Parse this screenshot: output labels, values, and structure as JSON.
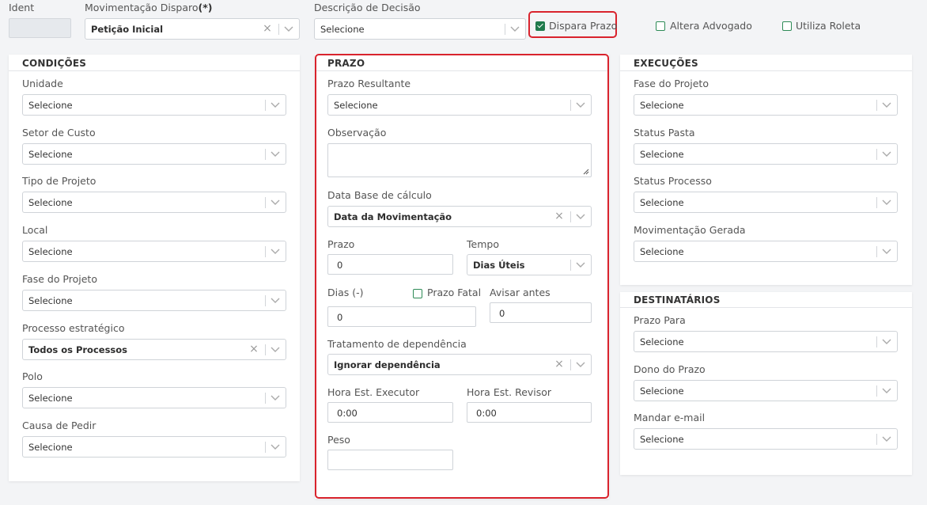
{
  "header": {
    "ident_label": "Ident",
    "movimentacao_label": "Movimentação Disparo",
    "movimentacao_required": "(*)",
    "movimentacao_value": "Petição Inicial",
    "descricao_label": "Descrição de Decisão",
    "descricao_value": "Selecione",
    "dispara_prazo_label": "Dispara Prazo",
    "altera_advogado_label": "Altera Advogado",
    "utiliza_roleta_label": "Utiliza Roleta"
  },
  "condicoes": {
    "title": "CONDIÇÕES",
    "fields": [
      {
        "label": "Unidade",
        "value": "Selecione"
      },
      {
        "label": "Setor de Custo",
        "value": "Selecione"
      },
      {
        "label": "Tipo de Projeto",
        "value": "Selecione"
      },
      {
        "label": "Local",
        "value": "Selecione"
      },
      {
        "label": "Fase do Projeto",
        "value": "Selecione"
      },
      {
        "label": "Processo estratégico",
        "value": "Todos os Processos"
      },
      {
        "label": "Polo",
        "value": "Selecione"
      },
      {
        "label": "Causa de Pedir",
        "value": "Selecione"
      }
    ]
  },
  "prazo": {
    "title": "PRAZO",
    "prazo_resultante_label": "Prazo Resultante",
    "prazo_resultante_value": "Selecione",
    "observacao_label": "Observação",
    "data_base_label": "Data Base de cálculo",
    "data_base_value": "Data da Movimentação",
    "prazo_label": "Prazo",
    "prazo_value": "0",
    "tempo_label": "Tempo",
    "tempo_value": "Dias Úteis",
    "dias_label": "Dias (-)",
    "dias_value": "0",
    "prazo_fatal_label": "Prazo Fatal",
    "avisar_label": "Avisar antes",
    "avisar_value": "0",
    "tratamento_label": "Tratamento de dependência",
    "tratamento_value": "Ignorar dependência",
    "hora_executor_label": "Hora Est. Executor",
    "hora_executor_value": "0:00",
    "hora_revisor_label": "Hora Est. Revisor",
    "hora_revisor_value": "0:00",
    "peso_label": "Peso",
    "peso_value": ""
  },
  "execucoes": {
    "title": "EXECUÇÕES",
    "fields": [
      {
        "label": "Fase do Projeto",
        "value": "Selecione"
      },
      {
        "label": "Status Pasta",
        "value": "Selecione"
      },
      {
        "label": "Status Processo",
        "value": "Selecione"
      },
      {
        "label": "Movimentação Gerada",
        "value": "Selecione"
      }
    ]
  },
  "destinatarios": {
    "title": "DESTINATÁRIOS",
    "fields": [
      {
        "label": "Prazo Para",
        "value": "Selecione"
      },
      {
        "label": "Dono do Prazo",
        "value": "Selecione"
      },
      {
        "label": "Mandar e-mail",
        "value": "Selecione"
      }
    ]
  },
  "colors": {
    "accent_green": "#1f7a4c",
    "highlight_red": "#d9232d"
  }
}
